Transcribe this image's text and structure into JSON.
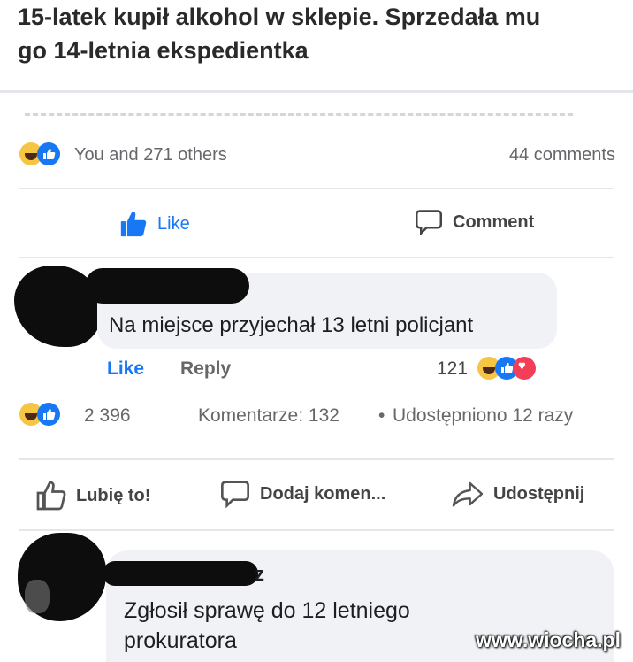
{
  "post": {
    "headline_line1": "15-latek kupił alkohol w sklepie. Sprzedała mu",
    "headline_line2": "go 14-letnia ekspedientka"
  },
  "inner_post": {
    "reactions_text": "You and 271 others",
    "comments_count": "44 comments",
    "like_label": "Like",
    "comment_label": "Comment",
    "comment": {
      "text": "Na miejsce przyjechał 13 letni policjant",
      "like_label": "Like",
      "reply_label": "Reply",
      "reaction_count": "121"
    }
  },
  "outer_post": {
    "reaction_count": "2 396",
    "comments_text": "Komentarze: 132",
    "separator": "•",
    "shares_text": "Udostępniono 12 razy",
    "like_label": "Lubię to!",
    "comment_label": "Dodaj komen...",
    "share_label": "Udostępnij",
    "comment": {
      "author_partial": "z",
      "text_line1": "Zgłosił sprawę do 12 letniego",
      "text_line2": "prokuratora"
    }
  },
  "watermark": "www.wiocha.pl",
  "colors": {
    "facebook_blue": "#1877f2",
    "haha_yellow": "#f7c544",
    "love_red": "#f33e58",
    "bubble_gray": "#f0f2f5"
  }
}
